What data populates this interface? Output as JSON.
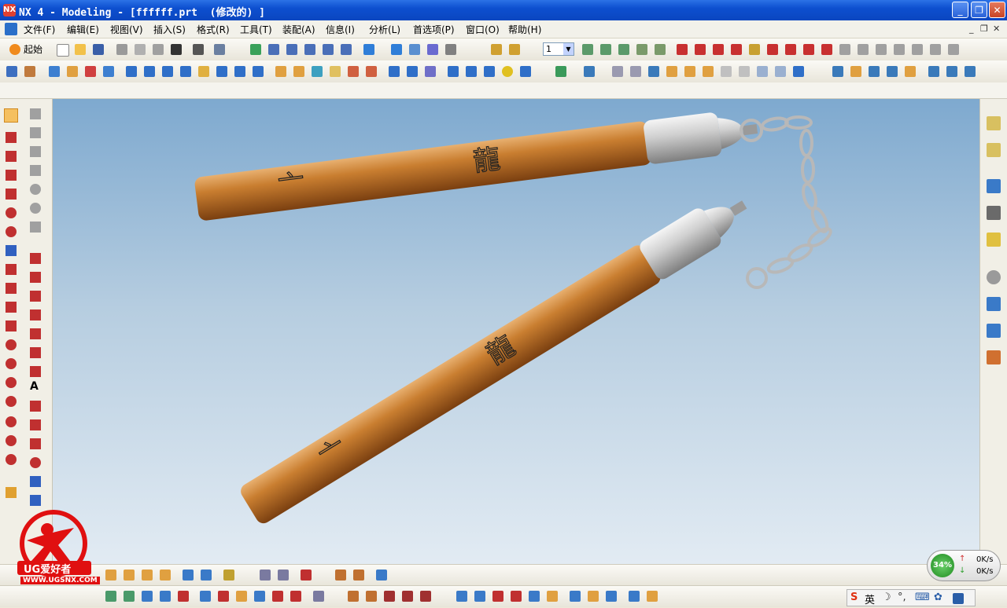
{
  "window": {
    "title": "NX 4 - Modeling - [ffffff.prt  (修改的) ]",
    "app_icon_text": "NX",
    "minimize_glyph": "_",
    "restore_glyph": "❐",
    "close_glyph": "✕"
  },
  "menu": {
    "items": [
      "文件(F)",
      "编辑(E)",
      "视图(V)",
      "插入(S)",
      "格式(R)",
      "工具(T)",
      "装配(A)",
      "信息(I)",
      "分析(L)",
      "首选项(P)",
      "窗口(O)",
      "帮助(H)"
    ],
    "mdi_minimize": "_",
    "mdi_restore": "❐",
    "mdi_close": "✕"
  },
  "toolbar": {
    "start_label": "起始",
    "layer_value": "1",
    "layer_arrow": "▼"
  },
  "network": {
    "percent": "34%",
    "up_speed": "0K/s",
    "down_speed": "0K/s",
    "up_arrow": "↑",
    "down_arrow": "↓"
  },
  "ime": {
    "logo": "S",
    "lang": "英",
    "moon": "☽",
    "punct": "°,",
    "keyboard": "⌨",
    "settings": "✿"
  },
  "watermark": {
    "brand": "UG爱好者",
    "url": "WWW.UGSNX.COM"
  },
  "colors": {
    "titlebar": "#0d4fcf",
    "viewport_top": "#7ea9cf",
    "viewport_bottom": "#e2ebf3",
    "wood": "#c47a2c",
    "metal": "#c4c4c4",
    "watermark_red": "#e01010"
  }
}
